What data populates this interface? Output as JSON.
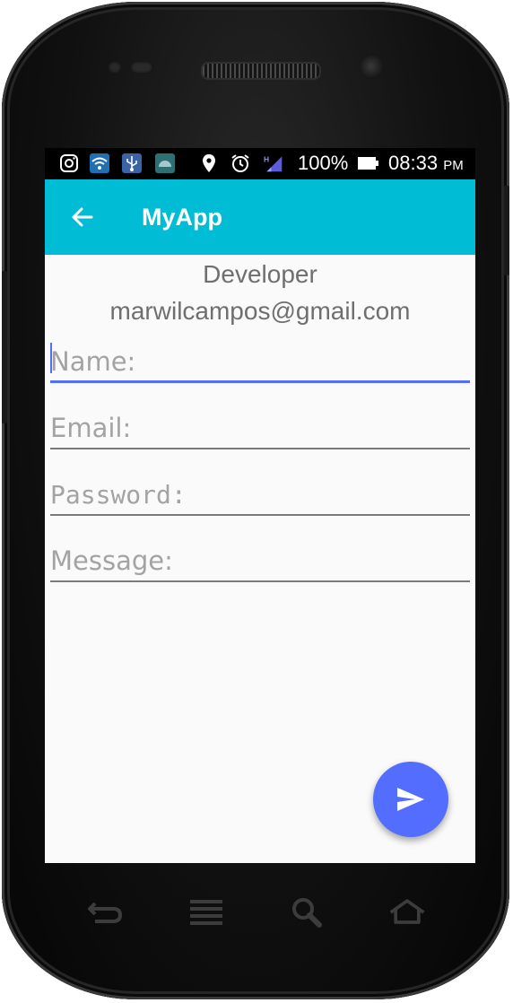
{
  "status_bar": {
    "battery": "100%",
    "time": "08:33",
    "ampm": "PM",
    "network_label": "H",
    "icons": [
      "instagram-icon",
      "wifi-icon",
      "usb-icon",
      "android-icon",
      "location-icon",
      "alarm-icon",
      "signal-icon",
      "battery-icon"
    ]
  },
  "app_bar": {
    "title": "MyApp",
    "back_icon": "arrow-back-icon",
    "color": "#00bcd4"
  },
  "developer": {
    "label": "Developer",
    "email": "marwilcampos@gmail.com"
  },
  "form": {
    "name_placeholder": "Name:",
    "email_placeholder": "Email:",
    "password_placeholder": "Password:",
    "message_placeholder": "Message:",
    "focused_field": "name"
  },
  "fab": {
    "icon": "send-icon",
    "color": "#536dfe"
  },
  "nav_bar": {
    "icons": [
      "back-nav-icon",
      "menu-icon",
      "search-icon",
      "home-icon"
    ]
  }
}
